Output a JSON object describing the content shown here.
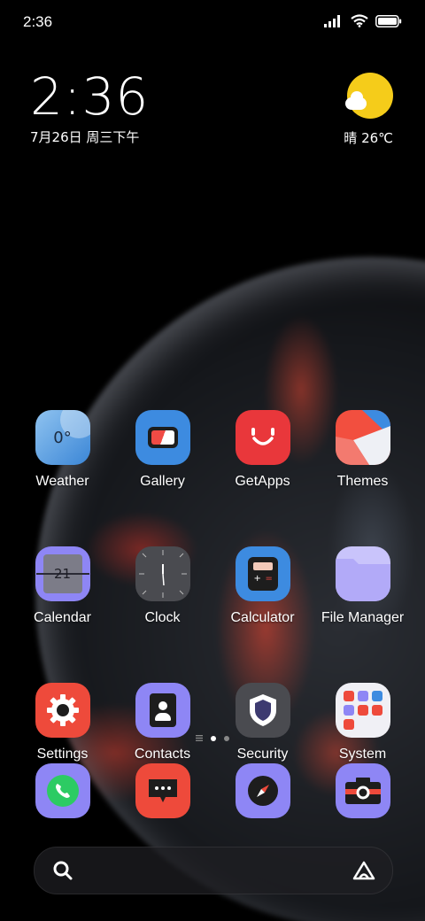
{
  "status_bar": {
    "time": "2:36"
  },
  "clock_widget": {
    "time": "2:36",
    "date": "7月26日 周三下午"
  },
  "weather_widget": {
    "text": "晴 26℃"
  },
  "apps": [
    {
      "label": "Weather",
      "icon": "weather-icon"
    },
    {
      "label": "Gallery",
      "icon": "gallery-icon"
    },
    {
      "label": "GetApps",
      "icon": "getapps-icon"
    },
    {
      "label": "Themes",
      "icon": "themes-icon"
    },
    {
      "label": "Calendar",
      "icon": "calendar-icon"
    },
    {
      "label": "Clock",
      "icon": "clock-icon"
    },
    {
      "label": "Calculator",
      "icon": "calculator-icon"
    },
    {
      "label": "File Manager",
      "icon": "folder-icon"
    },
    {
      "label": "Settings",
      "icon": "gear-icon"
    },
    {
      "label": "Contacts",
      "icon": "contacts-icon"
    },
    {
      "label": "Security",
      "icon": "shield-icon"
    },
    {
      "label": "System",
      "icon": "system-folder-icon"
    }
  ],
  "weather_icon_text": "0°",
  "calendar_icon_text": "21",
  "dock": [
    {
      "icon": "phone-icon"
    },
    {
      "icon": "messages-icon"
    },
    {
      "icon": "browser-icon"
    },
    {
      "icon": "camera-icon"
    }
  ],
  "page_indicator": {
    "pages": 2,
    "current": 1
  },
  "search_bar": {
    "icon": "search-icon",
    "right_icon": "assistant-icon"
  },
  "colors": {
    "accent_purple": "#8e86f5",
    "red": "#ee4a3b",
    "blue": "#3d8be0"
  }
}
